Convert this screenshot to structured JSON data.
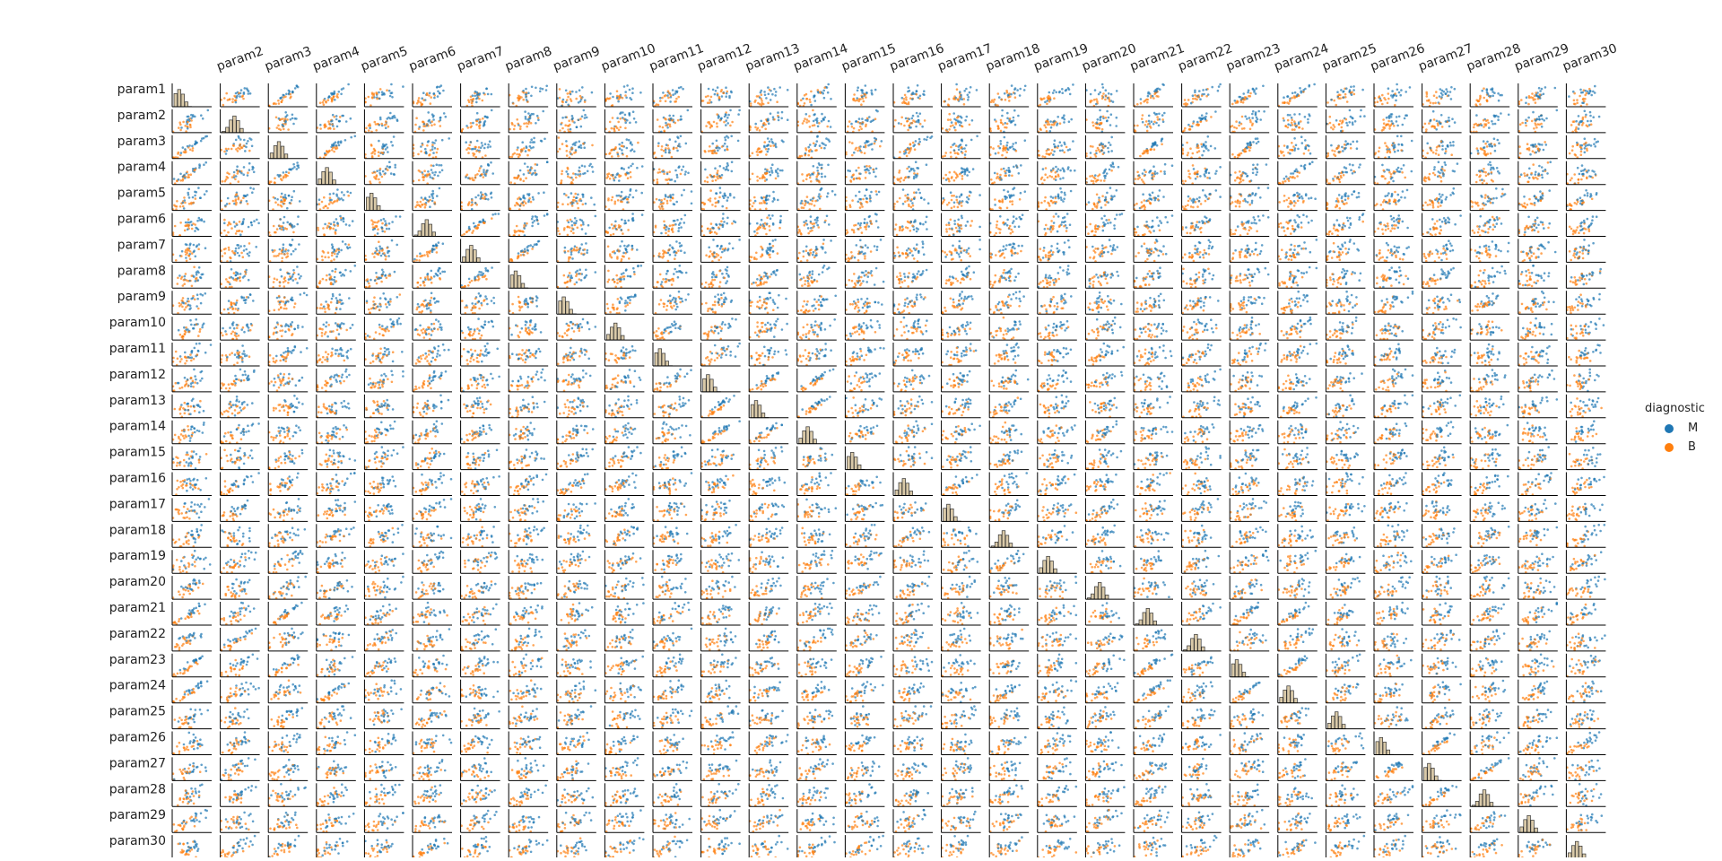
{
  "chart_data": {
    "type": "scatter",
    "subtype": "pairplot",
    "variables": [
      "param1",
      "param2",
      "param3",
      "param4",
      "param5",
      "param6",
      "param7",
      "param8",
      "param9",
      "param10",
      "param11",
      "param12",
      "param13",
      "param14",
      "param15",
      "param16",
      "param17",
      "param18",
      "param19",
      "param20",
      "param21",
      "param22",
      "param23",
      "param24",
      "param25",
      "param26",
      "param27",
      "param28",
      "param29",
      "param30"
    ],
    "column_labels": [
      "param2",
      "param3",
      "param4",
      "param5",
      "param6",
      "param7",
      "param8",
      "param9",
      "param10",
      "param11",
      "param12",
      "param13",
      "param14",
      "param15",
      "param16",
      "param17",
      "param18",
      "param19",
      "param20",
      "param21",
      "param22",
      "param23",
      "param24",
      "param25",
      "param26",
      "param27",
      "param28",
      "param29",
      "param30"
    ],
    "hue": "diagnostic",
    "legend": {
      "title": "diagnostic",
      "placement": "right",
      "entries": [
        {
          "name": "M",
          "color": "#1f77b4"
        },
        {
          "name": "B",
          "color": "#ff7f0e"
        }
      ]
    },
    "diagonal": "histogram",
    "strongly_correlated_pairs": [
      [
        "param1",
        "param3"
      ],
      [
        "param1",
        "param4"
      ],
      [
        "param3",
        "param4"
      ],
      [
        "param1",
        "param21"
      ],
      [
        "param1",
        "param23"
      ],
      [
        "param1",
        "param24"
      ],
      [
        "param3",
        "param21"
      ],
      [
        "param3",
        "param23"
      ],
      [
        "param4",
        "param24"
      ],
      [
        "param21",
        "param23"
      ],
      [
        "param21",
        "param24"
      ],
      [
        "param23",
        "param24"
      ],
      [
        "param2",
        "param22"
      ],
      [
        "param12",
        "param13"
      ],
      [
        "param12",
        "param14"
      ],
      [
        "param13",
        "param14"
      ],
      [
        "param6",
        "param7"
      ],
      [
        "param7",
        "param8"
      ],
      [
        "param26",
        "param27"
      ],
      [
        "param27",
        "param28"
      ]
    ],
    "grid": false,
    "axes_ticks": false
  },
  "colors": {
    "M": "#1f77b4",
    "B": "#ff7f0e",
    "axis": "#000000",
    "text": "#222222"
  }
}
